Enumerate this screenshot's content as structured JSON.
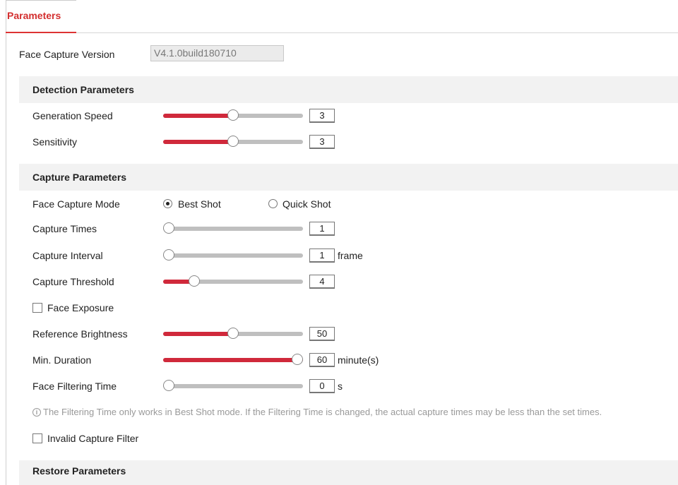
{
  "tab": {
    "label": "Parameters"
  },
  "version": {
    "label": "Face Capture Version",
    "value": "V4.1.0build180710"
  },
  "detection": {
    "title": "Detection Parameters",
    "generation_speed": {
      "label": "Generation Speed",
      "value": "3",
      "fraction": 0.5
    },
    "sensitivity": {
      "label": "Sensitivity",
      "value": "3",
      "fraction": 0.5
    }
  },
  "capture": {
    "title": "Capture Parameters",
    "mode": {
      "label": "Face Capture Mode",
      "options": [
        "Best Shot",
        "Quick Shot"
      ],
      "selected": "Best Shot"
    },
    "capture_times": {
      "label": "Capture Times",
      "value": "1",
      "fraction": 0.0
    },
    "capture_interval": {
      "label": "Capture Interval",
      "value": "1",
      "unit": "frame",
      "fraction": 0.0
    },
    "capture_threshold": {
      "label": "Capture Threshold",
      "value": "4",
      "fraction": 0.22
    },
    "face_exposure": {
      "label": "Face Exposure",
      "checked": false
    },
    "reference_brightness": {
      "label": "Reference Brightness",
      "value": "50",
      "fraction": 0.5
    },
    "min_duration": {
      "label": "Min. Duration",
      "value": "60",
      "unit": "minute(s)",
      "fraction": 1.0
    },
    "face_filtering_time": {
      "label": "Face Filtering Time",
      "value": "0",
      "unit": "s",
      "fraction": 0.0
    },
    "note": "The Filtering Time only works in Best Shot mode. If the Filtering Time is changed, the actual capture times may be less than the set times.",
    "invalid_capture_filter": {
      "label": "Invalid Capture Filter",
      "checked": false
    }
  },
  "restore": {
    "title": "Restore Parameters"
  },
  "colors": {
    "accent": "#d32f2f",
    "slider_fill": "#d0293b",
    "slider_track": "#bfbfbf",
    "section_bg": "#f2f2f2"
  }
}
